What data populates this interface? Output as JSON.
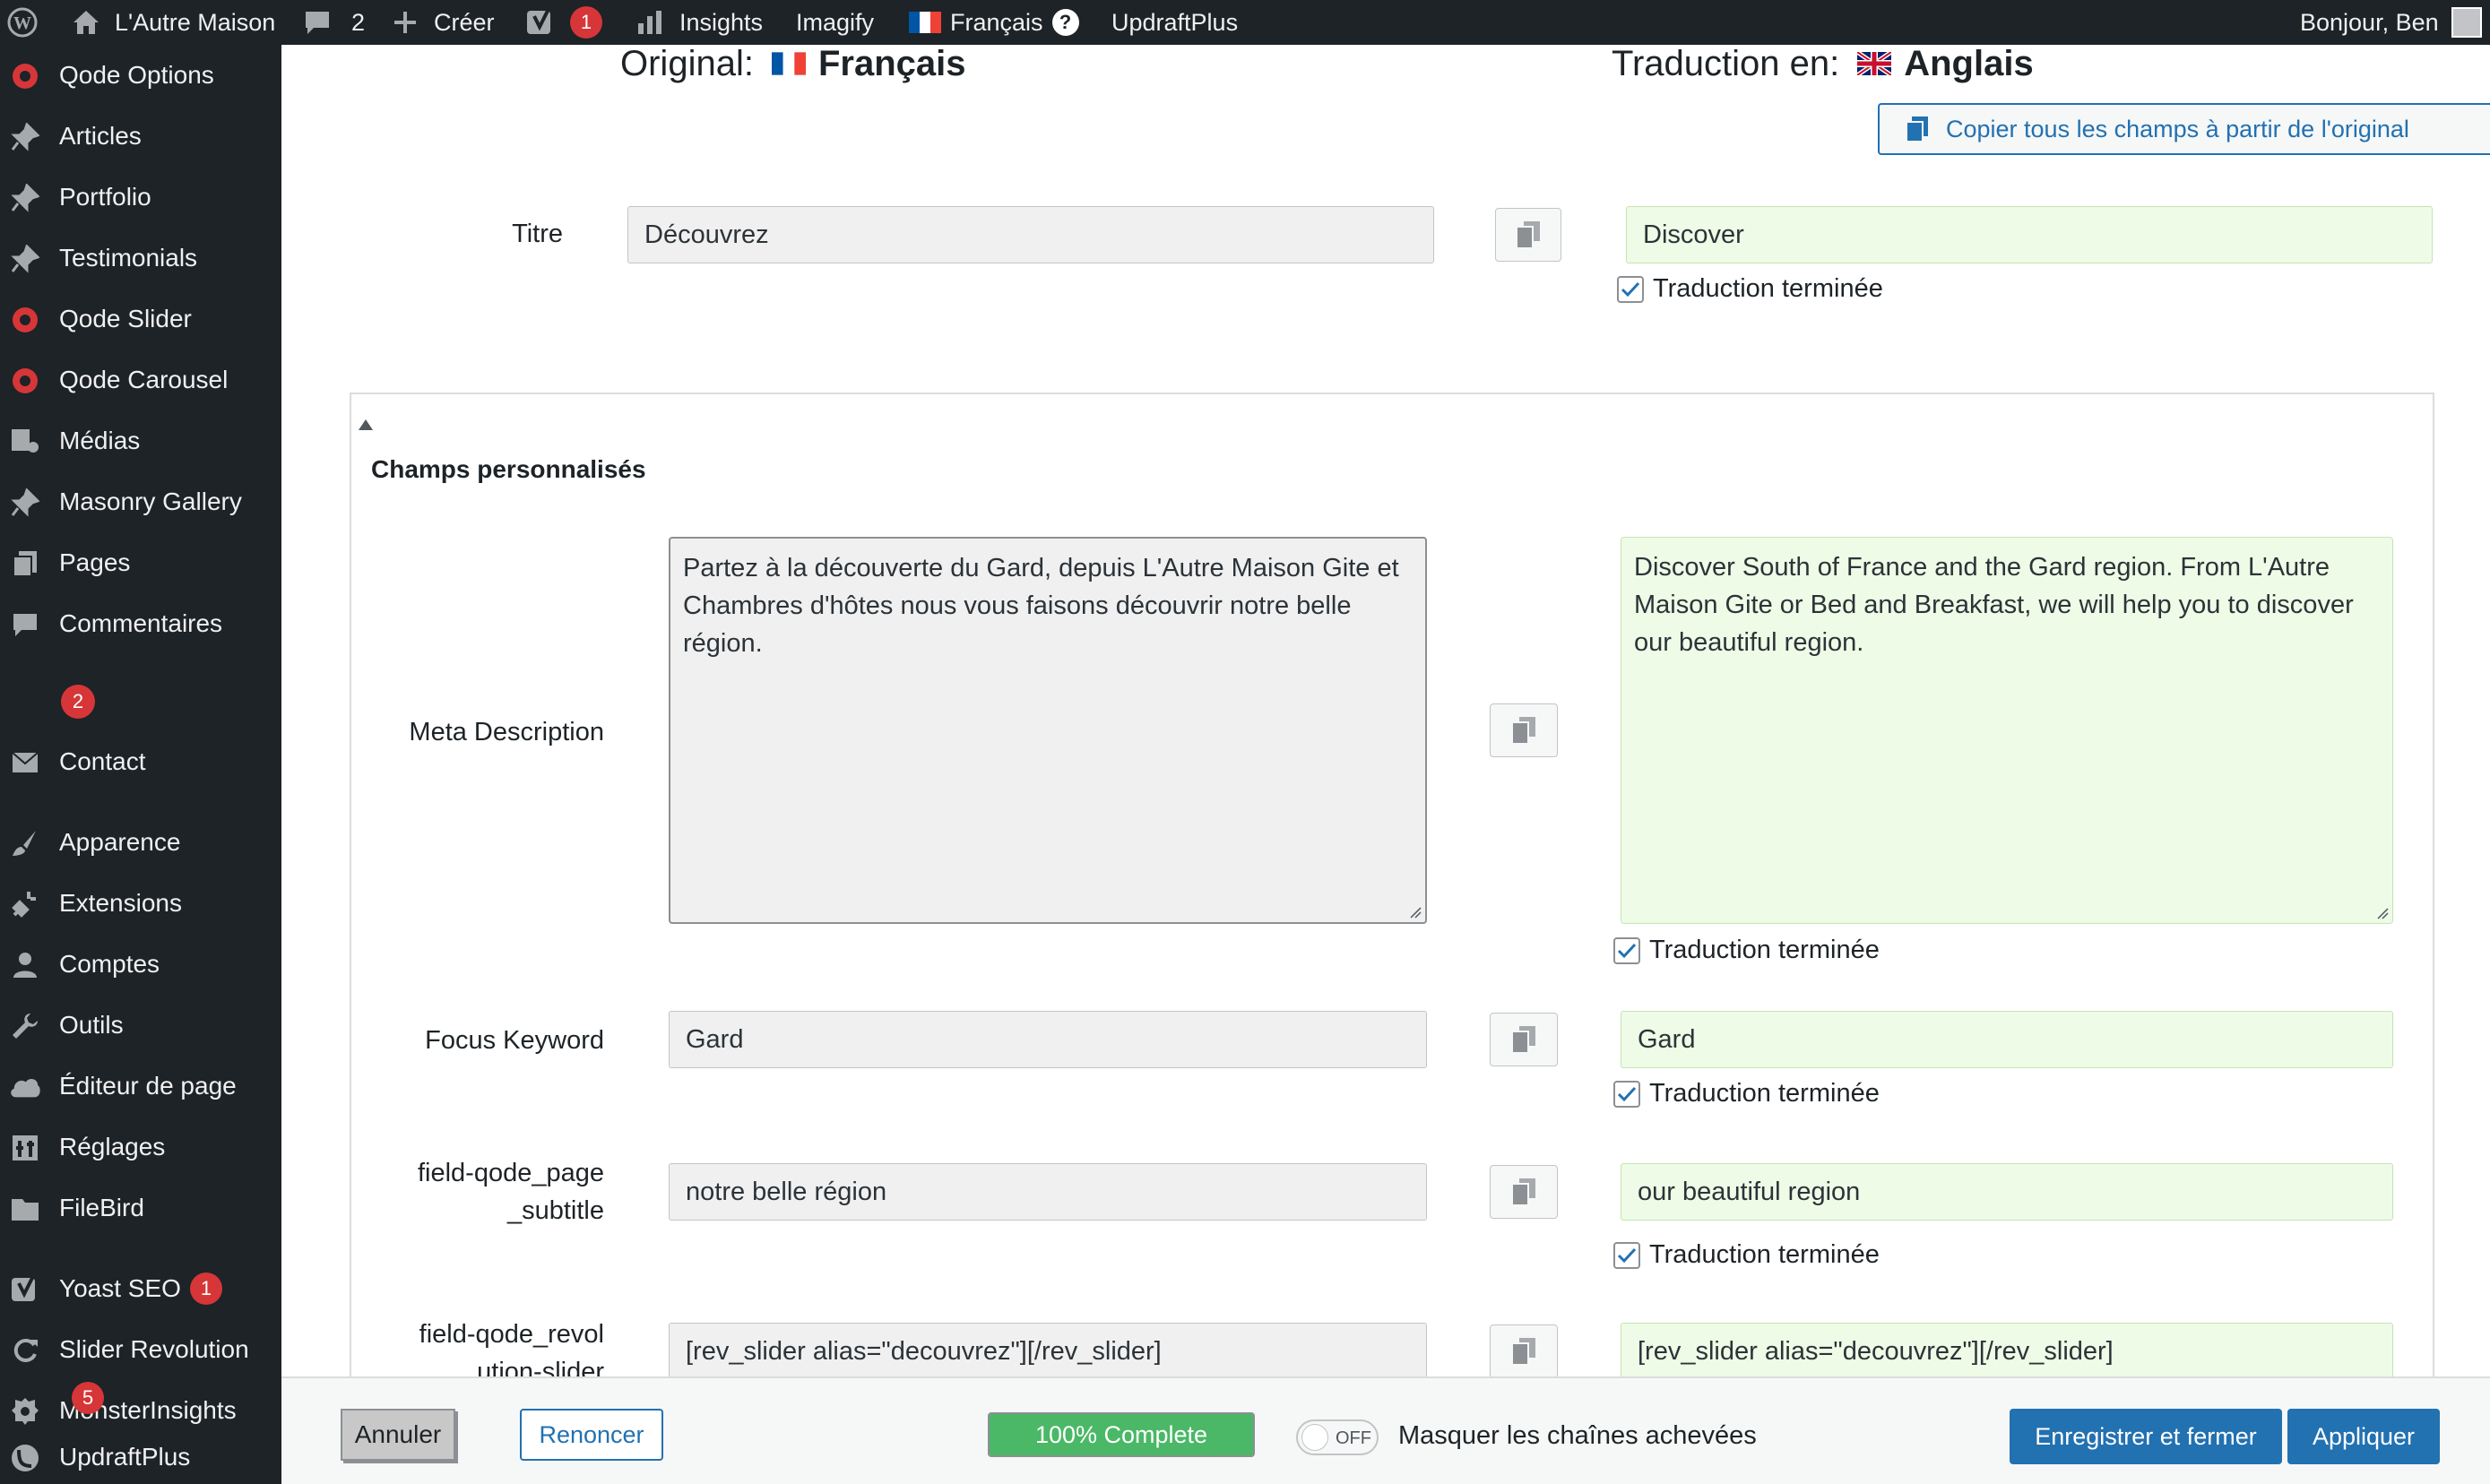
{
  "adminbar": {
    "site_name": "L'Autre Maison",
    "comments_count": "2",
    "create_label": "Créer",
    "yoast_badge": "1",
    "insights_label": "Insights",
    "imagify_label": "Imagify",
    "language_label": "Français",
    "help_label": "?",
    "updraft_label": "UpdraftPlus",
    "greeting": "Bonjour, Ben"
  },
  "sidebar": {
    "items": [
      {
        "label": "Qode Options",
        "icon": "qode-icon"
      },
      {
        "label": "Articles",
        "icon": "pin-icon"
      },
      {
        "label": "Portfolio",
        "icon": "pin-icon"
      },
      {
        "label": "Testimonials",
        "icon": "pin-icon"
      },
      {
        "label": "Qode Slider",
        "icon": "qode-icon"
      },
      {
        "label": "Qode Carousel",
        "icon": "qode-icon"
      },
      {
        "label": "Médias",
        "icon": "media-icon"
      },
      {
        "label": "Masonry Gallery",
        "icon": "pin-icon"
      },
      {
        "label": "Pages",
        "icon": "pages-icon"
      },
      {
        "label": "Commentaires",
        "icon": "comment-icon",
        "badge": "2"
      },
      {
        "label": "Contact",
        "icon": "mail-icon"
      },
      {
        "label": "Apparence",
        "icon": "brush-icon"
      },
      {
        "label": "Extensions",
        "icon": "plugin-icon"
      },
      {
        "label": "Comptes",
        "icon": "user-icon"
      },
      {
        "label": "Outils",
        "icon": "wrench-icon"
      },
      {
        "label": "Éditeur de page",
        "icon": "cloud-icon"
      },
      {
        "label": "Réglages",
        "icon": "settings-icon"
      },
      {
        "label": "FileBird",
        "icon": "filebird-icon"
      },
      {
        "label": "Yoast SEO",
        "icon": "yoast-icon",
        "badge": "1"
      },
      {
        "label": "Slider Revolution",
        "icon": "refresh-icon"
      },
      {
        "label": "MonsterInsights",
        "icon": "monster-icon",
        "badge": "5"
      },
      {
        "label": "UpdraftPlus",
        "icon": "updraft-icon"
      }
    ]
  },
  "header": {
    "original_label": "Original:",
    "original_lang": "Français",
    "translation_label": "Traduction en:",
    "translation_lang": "Anglais",
    "copy_all_label": "Copier tous les champs à partir de l'original"
  },
  "fields": {
    "title": {
      "label": "Titre",
      "original": "Découvrez",
      "translation": "Discover",
      "complete_label": "Traduction terminée"
    },
    "custom_fields_title": "Champs personnalisés",
    "meta_description": {
      "label": "Meta Description",
      "original": "Partez à la découverte du Gard, depuis L'Autre Maison Gite et Chambres d'hôtes nous vous faisons découvrir notre belle région.",
      "translation": "Discover South of France and the Gard region. From L'Autre Maison Gite or Bed and Breakfast, we will help you to discover our beautiful region.",
      "complete_label": "Traduction terminée"
    },
    "focus_keyword": {
      "label": "Focus Keyword",
      "original": "Gard",
      "translation": "Gard",
      "complete_label": "Traduction terminée"
    },
    "page_subtitle": {
      "label_line1": "field-qode_page",
      "label_line2": "_subtitle",
      "original": "notre belle région",
      "translation": "our beautiful region",
      "complete_label": "Traduction terminée"
    },
    "revolution_slider": {
      "label_line1": "field-qode_revol",
      "label_line2": "ution-slider",
      "original": "[rev_slider alias=\"decouvrez\"][/rev_slider]",
      "translation": "[rev_slider alias=\"decouvrez\"][/rev_slider]"
    }
  },
  "footer": {
    "cancel_label": "Annuler",
    "discard_label": "Renoncer",
    "progress_text": "100% Complete",
    "progress_fraction": 1.0,
    "toggle_state": "OFF",
    "toggle_label": "Masquer les chaînes achevées",
    "save_close_label": "Enregistrer et fermer",
    "apply_label": "Appliquer"
  },
  "colors": {
    "admin_dark": "#1d2327",
    "accent_blue": "#2271b1",
    "badge_red": "#d63638",
    "translated_bg": "#eefbe6",
    "progress_green": "#4ab866"
  }
}
